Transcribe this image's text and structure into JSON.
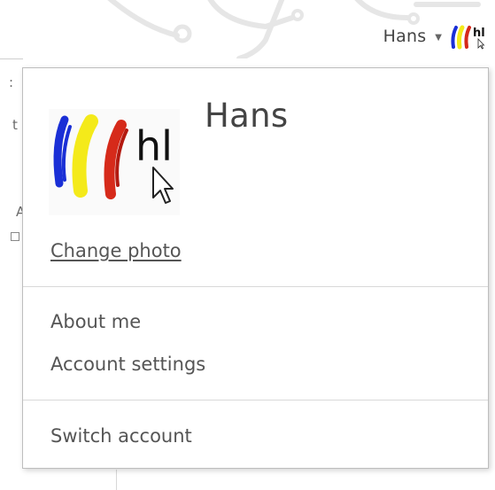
{
  "header": {
    "account_name": "Hans",
    "caret_glyph": "▼"
  },
  "background": {
    "fragment_1": ":",
    "fragment_2": "t",
    "fragment_3": "A"
  },
  "dropdown": {
    "profile_name": "Hans",
    "avatar_text": "hl",
    "change_photo_label": "Change photo",
    "about_me_label": "About me",
    "account_settings_label": "Account settings",
    "switch_account_label": "Switch account"
  },
  "colors": {
    "avatar_blue": "#1a2fd6",
    "avatar_yellow": "#f4ea1a",
    "avatar_red": "#d62a1a",
    "text": "#444444",
    "divider": "#d9d9d9"
  },
  "icons": {
    "caret": "chevron-down-icon",
    "avatar_cursor": "mouse-pointer-icon"
  }
}
